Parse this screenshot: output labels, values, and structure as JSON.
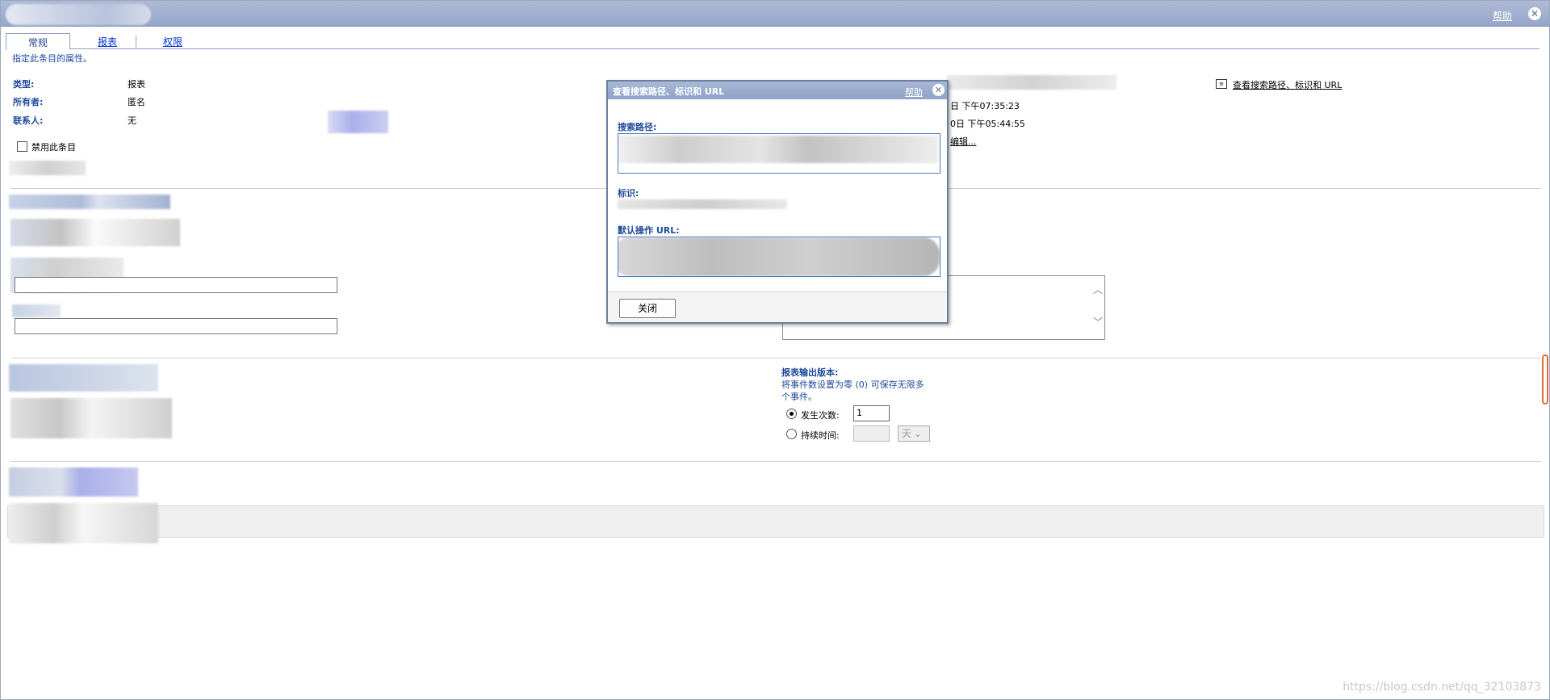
{
  "titlebar": {
    "help": "帮助",
    "close": "✕"
  },
  "tabs": [
    {
      "label": "常规"
    },
    {
      "label": "报表"
    },
    {
      "label": "权限"
    }
  ],
  "hint": "指定此条目的属性。",
  "properties": {
    "type_label": "类型:",
    "type_value": "报表",
    "owner_label": "所有者:",
    "owner_value": "匿名",
    "contact_label": "联系人:",
    "contact_value": "无"
  },
  "disable_entry": "禁用此条目",
  "right": {
    "date1": "日 下午07:35:23",
    "date2": "0日 下午05:44:55",
    "edit_link": "编辑...",
    "view_link": "查看搜索路径、标识和 URL"
  },
  "output": {
    "label": "报表输出版本:",
    "desc": "将事件数设置为零 (0) 可保存无限多个事件。",
    "occurrences_label": "发生次数:",
    "occurrences_value": "1",
    "duration_label": "持续时间:",
    "duration_unit": "天"
  },
  "modal": {
    "title": "查看搜索路径、标识和 URL",
    "help": "帮助",
    "search_path_label": "搜索路径:",
    "id_label": "标识:",
    "default_url_label": "默认操作 URL:",
    "close_button": "关闭"
  },
  "watermark": "https://blog.csdn.net/qq_32103873"
}
